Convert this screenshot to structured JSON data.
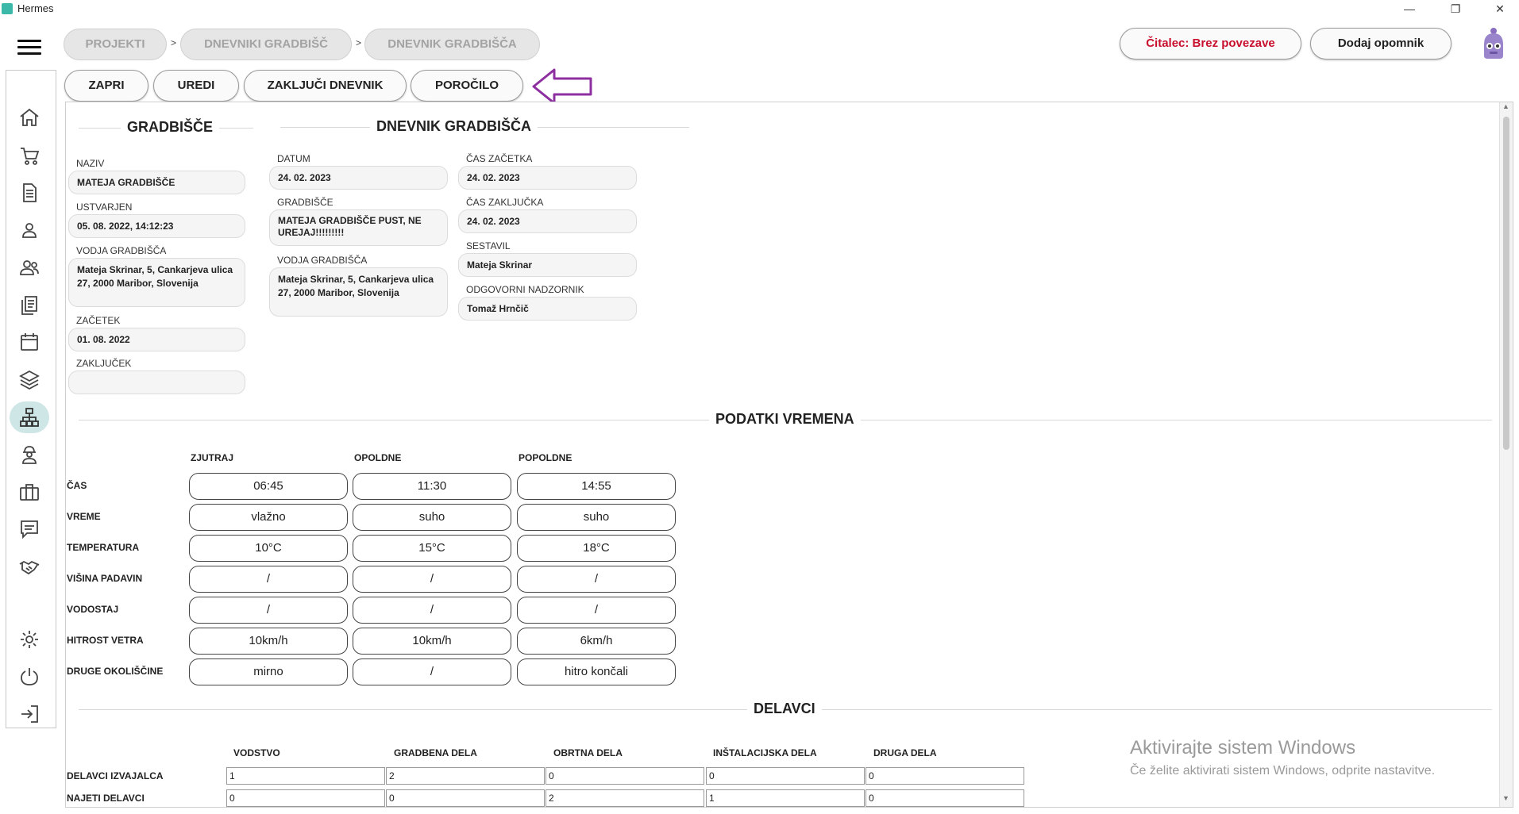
{
  "window": {
    "title": "Hermes",
    "minimize": "—",
    "maximize": "❐",
    "close": "✕"
  },
  "breadcrumbs": [
    {
      "label": "PROJEKTI"
    },
    {
      "label": "DNEVNIKI GRADBIŠČ"
    },
    {
      "label": "DNEVNIK GRADBIŠČA"
    }
  ],
  "breadcrumb_sep": ">",
  "header": {
    "reader_status": "Čitalec: Brez povezave",
    "add_reminder": "Dodaj opomnik"
  },
  "toolbar": {
    "close": "ZAPRI",
    "edit": "UREDI",
    "finish": "ZAKLJUČI DNEVNIK",
    "report": "POROČILO"
  },
  "colors": {
    "accent": "#cfe6e6",
    "arrow": "#8e2fa0",
    "status_red": "#c8102e"
  },
  "sidebar": {
    "icons": [
      "home-icon",
      "cart-icon",
      "document-icon",
      "user-icon",
      "users-icon",
      "notes-icon",
      "calendar-icon",
      "layers-icon",
      "network-icon",
      "worker-icon",
      "briefcase-icon",
      "chat-icon",
      "handshake-icon",
      "gear-icon",
      "power-icon",
      "logout-icon"
    ],
    "active": "network-icon"
  },
  "site": {
    "title": "GRADBIŠČE",
    "name_label": "NAZIV",
    "name": "MATEJA GRADBIŠČE",
    "created_label": "USTVARJEN",
    "created": "05. 08. 2022, 14:12:23",
    "manager_label": "VODJA GRADBIŠČA",
    "manager": "Mateja Skrinar, 5, Cankarjeva ulica 27, 2000 Maribor, Slovenija",
    "start_label": "ZAČETEK",
    "start": "01. 08. 2022",
    "end_label": "ZAKLJUČEK",
    "end": ""
  },
  "diary": {
    "title": "DNEVNIK GRADBIŠČA",
    "date_label": "DATUM",
    "date": "24. 02. 2023",
    "site_label": "GRADBIŠČE",
    "site": "MATEJA GRADBIŠČE PUST, NE UREJAJ!!!!!!!!!",
    "manager_label": "VODJA GRADBIŠČA",
    "manager": "Mateja Skrinar, 5, Cankarjeva ulica 27, 2000 Maribor, Slovenija",
    "start_time_label": "ČAS ZAČETKA",
    "start_time": "24. 02. 2023",
    "end_time_label": "ČAS ZAKLJUČKA",
    "end_time": "24. 02. 2023",
    "author_label": "SESTAVIL",
    "author": "Mateja Skrinar",
    "supervisor_label": "ODGOVORNI NADZORNIK",
    "supervisor": "Tomaž Hrnčič"
  },
  "weather": {
    "title": "PODATKI VREMENA",
    "columns": [
      "ZJUTRAJ",
      "OPOLDNE",
      "POPOLDNE"
    ],
    "rows": [
      {
        "label": "ČAS",
        "values": [
          "06:45",
          "11:30",
          "14:55"
        ]
      },
      {
        "label": "VREME",
        "values": [
          "vlažno",
          "suho",
          "suho"
        ]
      },
      {
        "label": "TEMPERATURA",
        "values": [
          "10°C",
          "15°C",
          "18°C"
        ]
      },
      {
        "label": "VIŠINA PADAVIN",
        "values": [
          "/",
          "/",
          "/"
        ]
      },
      {
        "label": "VODOSTAJ",
        "values": [
          "/",
          "/",
          "/"
        ]
      },
      {
        "label": "HITROST VETRA",
        "values": [
          "10km/h",
          "10km/h",
          "6km/h"
        ]
      },
      {
        "label": "DRUGE OKOLIŠČINE",
        "values": [
          "mirno",
          "/",
          "hitro končali"
        ]
      }
    ]
  },
  "workers": {
    "title": "DELAVCI",
    "columns": [
      "VODSTVO",
      "GRADBENA DELA",
      "OBRTNA DELA",
      "INŠTALACIJSKA DELA",
      "DRUGA DELA"
    ],
    "rows": [
      {
        "label": "DELAVCI IZVAJALCA",
        "values": [
          "1",
          "2",
          "0",
          "0",
          "0"
        ]
      },
      {
        "label": "NAJETI DELAVCI",
        "values": [
          "0",
          "0",
          "2",
          "1",
          "0"
        ]
      }
    ]
  },
  "watermark": {
    "line1": "Aktivirajte sistem Windows",
    "line2": "Če želite aktivirati sistem Windows, odprite nastavitve."
  }
}
